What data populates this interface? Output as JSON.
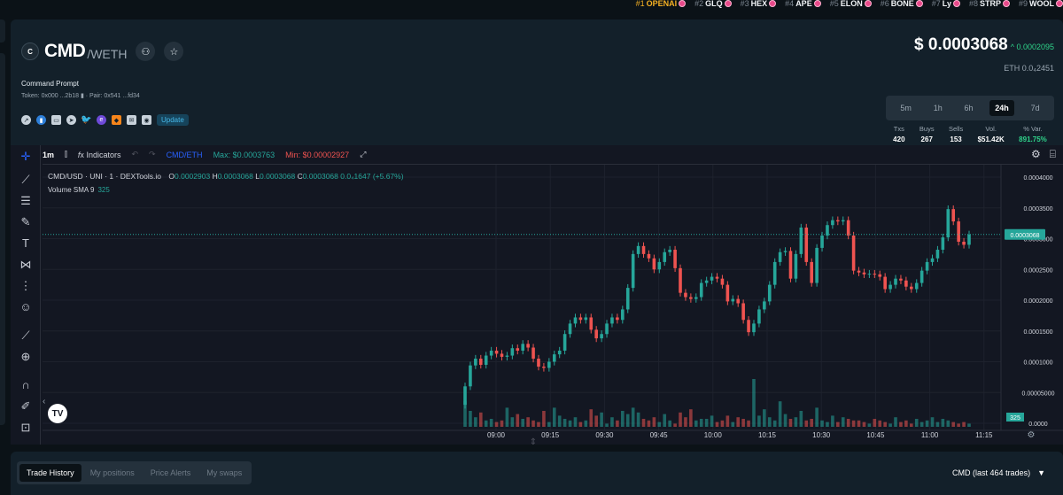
{
  "ticker": [
    {
      "rank": "#1",
      "symbol": "OPENAI"
    },
    {
      "rank": "#2",
      "symbol": "GLQ"
    },
    {
      "rank": "#3",
      "symbol": "HEX"
    },
    {
      "rank": "#4",
      "symbol": "APE"
    },
    {
      "rank": "#5",
      "symbol": "ELON"
    },
    {
      "rank": "#6",
      "symbol": "BONE"
    },
    {
      "rank": "#7",
      "symbol": "Ly"
    },
    {
      "rank": "#8",
      "symbol": "STRP"
    },
    {
      "rank": "#9",
      "symbol": "WOOL"
    }
  ],
  "token": {
    "logo_letter": "C",
    "symbol": "CMD",
    "pair": "/WETH",
    "name": "Command Prompt",
    "addresses": "Token: 0x000 ...2b18  ▮ · Pair: 0x541 ...fd34",
    "update_label": "Update"
  },
  "price": {
    "usd": "$ 0.0003068",
    "change": "0.0002095",
    "eth": "ETH  0.0₄2451"
  },
  "timeframes": [
    "5m",
    "1h",
    "6h",
    "24h",
    "7d"
  ],
  "active_timeframe": "24h",
  "stats": [
    {
      "label": "Txs",
      "value": "420",
      "green": false
    },
    {
      "label": "Buys",
      "value": "267",
      "green": false
    },
    {
      "label": "Sells",
      "value": "153",
      "green": false
    },
    {
      "label": "Vol.",
      "value": "$51.42K",
      "green": false
    },
    {
      "label": "% Var.",
      "value": "891.75%",
      "green": true
    }
  ],
  "toolbar": {
    "interval": "1m",
    "indicators": "Indicators",
    "pair_toggle": "CMD/ETH",
    "max": "Max: $0.0003763",
    "min": "Min: $0.00002927"
  },
  "legend": {
    "title": "CMD/USD · UNI · 1 · DEXTools.io",
    "o": "0.0002903",
    "h": "0.0003068",
    "l": "0.0003068",
    "c": "0.0003068",
    "change": "0.0₄1647 (+5.67%)",
    "volume_label": "Volume SMA 9",
    "volume_value": "325"
  },
  "chart_data": {
    "type": "candlestick",
    "x_ticks": [
      "09:00",
      "09:15",
      "09:30",
      "09:45",
      "10:00",
      "10:15",
      "10:30",
      "10:45",
      "11:00",
      "11:15"
    ],
    "y_ticks": [
      "0.0004000",
      "0.0003500",
      "0.0003000",
      "0.0002500",
      "0.0002000",
      "0.0001500",
      "0.0001000",
      "0.00005000",
      "0.0000"
    ],
    "ylim": [
      0,
      0.0004
    ],
    "last_price_label": "0.0003068",
    "last_price": 0.0003068,
    "volume_label": "325",
    "close": [
      6e-05,
      9.4e-05,
      0.000105,
      9.5e-05,
      0.00011,
      0.000118,
      0.000113,
      0.000108,
      0.00011,
      0.000122,
      0.000118,
      0.000129,
      0.000123,
      0.000105,
      9.2e-05,
      9e-05,
      0.0001,
      0.000112,
      0.000118,
      0.000145,
      0.000162,
      0.000172,
      0.000168,
      0.000172,
      0.000152,
      0.000138,
      0.000145,
      0.000162,
      0.000172,
      0.000168,
      0.000185,
      0.00022,
      0.000275,
      0.000288,
      0.000275,
      0.000268,
      0.00025,
      0.000262,
      0.000278,
      0.000282,
      0.000252,
      0.000212,
      0.000205,
      0.000202,
      0.000205,
      0.000228,
      0.000232,
      0.000238,
      0.000235,
      0.000225,
      0.000198,
      0.000202,
      0.000195,
      0.000168,
      0.000148,
      0.000162,
      0.000185,
      0.000198,
      0.000225,
      0.000262,
      0.000278,
      0.00028,
      0.000235,
      0.000275,
      0.000318,
      0.000262,
      0.000228,
      0.000285,
      0.000305,
      0.000322,
      0.00033,
      0.000328,
      0.00033,
      0.000305,
      0.000248,
      0.000245,
      0.000242,
      0.000243,
      0.000242,
      0.000238,
      0.000218,
      0.000225,
      0.000235,
      0.000232,
      0.000222,
      0.000218,
      0.000228,
      0.000248,
      0.000262,
      0.000268,
      0.000282,
      0.000302,
      0.000348,
      0.000328,
      0.000295,
      0.00029,
      0.0003068
    ],
    "volume": [
      16,
      10,
      6,
      9,
      4,
      5,
      3,
      4,
      12,
      6,
      8,
      5,
      6,
      4,
      3,
      10,
      3,
      12,
      7,
      5,
      4,
      6,
      3,
      4,
      11,
      7,
      9,
      2,
      6,
      4,
      10,
      8,
      12,
      9,
      5,
      4,
      6,
      3,
      8,
      4,
      2,
      9,
      6,
      11,
      4,
      5,
      5,
      7,
      3,
      4,
      7,
      3,
      6,
      5,
      4,
      30,
      7,
      11,
      6,
      4,
      16,
      8,
      5,
      6,
      10,
      4,
      5,
      12,
      4,
      3,
      7,
      3,
      6,
      5,
      4,
      4,
      3,
      2,
      5,
      4,
      3,
      2,
      6,
      3,
      4,
      2,
      5,
      3,
      4,
      6,
      3,
      5,
      4,
      3,
      2,
      3,
      2
    ]
  },
  "bottom": {
    "tabs": [
      "Trade History",
      "My positions",
      "Price Alerts",
      "My swaps"
    ],
    "trades_label": "CMD (last 464 trades)"
  }
}
